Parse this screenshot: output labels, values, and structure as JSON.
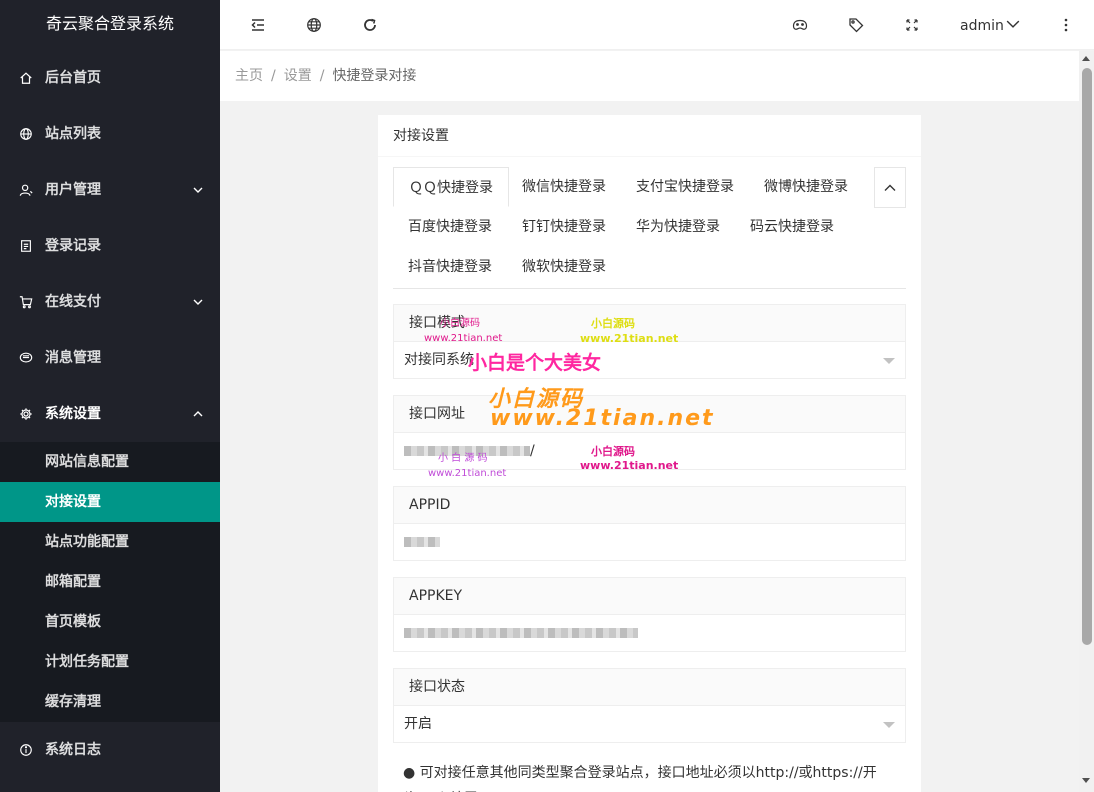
{
  "app": {
    "title": "奇云聚合登录系统"
  },
  "sidebar": {
    "items": [
      {
        "label": "后台首页",
        "icon": "home-icon"
      },
      {
        "label": "站点列表",
        "icon": "globe-icon"
      },
      {
        "label": "用户管理",
        "icon": "user-icon",
        "expandable": true
      },
      {
        "label": "登录记录",
        "icon": "document-icon"
      },
      {
        "label": "在线支付",
        "icon": "cart-icon",
        "expandable": true
      },
      {
        "label": "消息管理",
        "icon": "chat-icon"
      },
      {
        "label": "系统设置",
        "icon": "gear-icon",
        "expandable": true,
        "open": true
      },
      {
        "label": "系统日志",
        "icon": "info-icon"
      }
    ],
    "submenu": [
      {
        "label": "网站信息配置"
      },
      {
        "label": "对接设置",
        "active": true
      },
      {
        "label": "站点功能配置"
      },
      {
        "label": "邮箱配置"
      },
      {
        "label": "首页模板"
      },
      {
        "label": "计划任务配置"
      },
      {
        "label": "缓存清理"
      }
    ]
  },
  "header": {
    "user": "admin"
  },
  "breadcrumb": {
    "items": [
      "主页",
      "设置",
      "快捷登录对接"
    ]
  },
  "card": {
    "title": "对接设置",
    "tabs": [
      "ＱＱ快捷登录",
      "微信快捷登录",
      "支付宝快捷登录",
      "微博快捷登录",
      "百度快捷登录",
      "钉钉快捷登录",
      "华为快捷登录",
      "码云快捷登录",
      "抖音快捷登录",
      "微软快捷登录"
    ],
    "active_tab": 0,
    "fields": [
      {
        "label": "接口模式",
        "value": "对接同系统",
        "type": "select"
      },
      {
        "label": "接口网址",
        "value": "",
        "type": "text",
        "suffix": "/"
      },
      {
        "label": "APPID",
        "value": "",
        "type": "text"
      },
      {
        "label": "APPKEY",
        "value": "",
        "type": "text"
      },
      {
        "label": "接口状态",
        "value": "开启",
        "type": "select"
      }
    ],
    "note": "● 可对接任意其他同类型聚合登录站点，接口地址必须以http://或https://开头，以/结尾"
  },
  "watermarks": {
    "small_a": "小白源码",
    "small_a_url": "www.21tian.net",
    "small_b": "小白源码",
    "small_b_url": "www.21tian.net",
    "big_pink": "小白是个大美女",
    "big_orange": "小白源码",
    "big_orange_url": "www.21tian.net",
    "small_c": "小 白 源 码",
    "small_c_url": "www.21tian.net",
    "small_d": "小白源码",
    "small_d_url": "www.21tian.net"
  },
  "colors": {
    "sidebar_bg": "#20222a",
    "submenu_bg": "#171a20",
    "accent": "#009688"
  }
}
